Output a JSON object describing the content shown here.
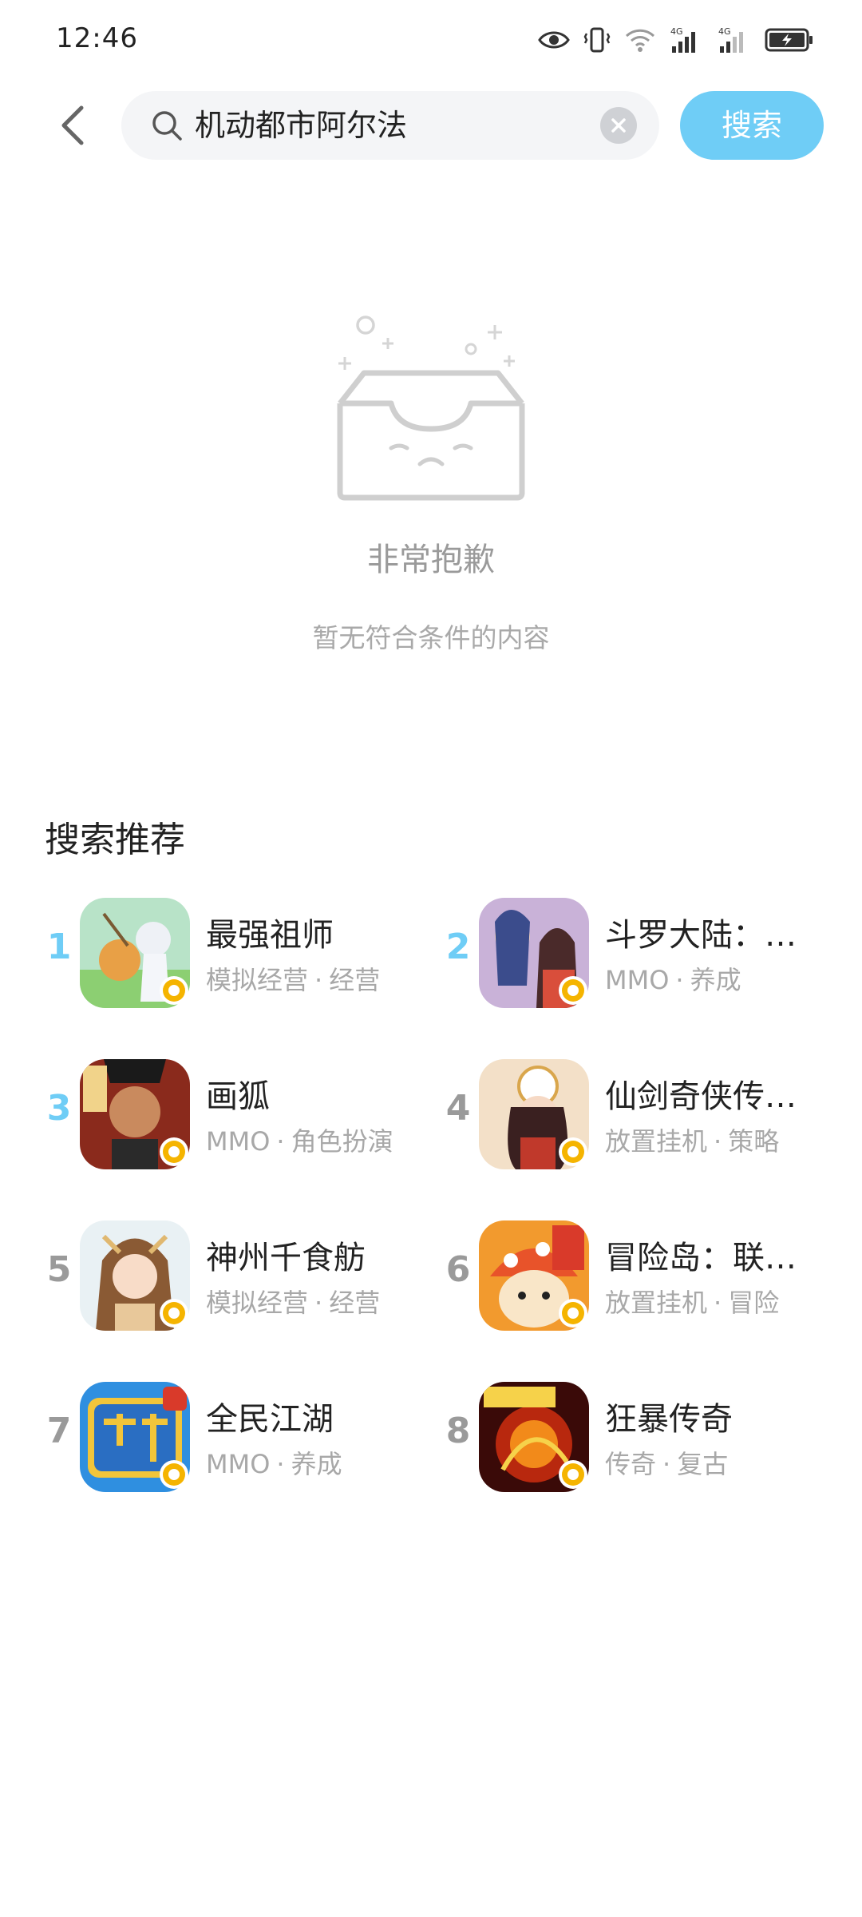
{
  "status_bar": {
    "time": "12:46",
    "icons": [
      "eye-icon",
      "vibrate-icon",
      "wifi-icon",
      "signal-4g-icon",
      "signal-4g-icon",
      "battery-charging-icon"
    ],
    "net_label_1": "4G",
    "net_label_2": "4G"
  },
  "search": {
    "query": "机动都市阿尔法",
    "button_label": "搜索"
  },
  "empty_state": {
    "title": "非常抱歉",
    "subtitle": "暂无符合条件的内容"
  },
  "recommendations": {
    "title": "搜索推荐",
    "items": [
      {
        "rank": "1",
        "name": "最强祖师",
        "tag1": "模拟经营",
        "tag2": "经营",
        "top": true
      },
      {
        "rank": "2",
        "name": "斗罗大陆：…",
        "tag1": "MMO",
        "tag2": "养成",
        "top": true
      },
      {
        "rank": "3",
        "name": "画狐",
        "tag1": "MMO",
        "tag2": "角色扮演",
        "top": true
      },
      {
        "rank": "4",
        "name": "仙剑奇侠传…",
        "tag1": "放置挂机",
        "tag2": "策略",
        "top": false
      },
      {
        "rank": "5",
        "name": "神州千食舫",
        "tag1": "模拟经营",
        "tag2": "经营",
        "top": false
      },
      {
        "rank": "6",
        "name": "冒险岛：联…",
        "tag1": "放置挂机",
        "tag2": "冒险",
        "top": false
      },
      {
        "rank": "7",
        "name": "全民江湖",
        "tag1": "MMO",
        "tag2": "养成",
        "top": false
      },
      {
        "rank": "8",
        "name": "狂暴传奇",
        "tag1": "传奇",
        "tag2": "复古",
        "top": false
      }
    ]
  },
  "colors": {
    "accent": "#6fcdf6",
    "muted_text": "#a8a8a8"
  }
}
